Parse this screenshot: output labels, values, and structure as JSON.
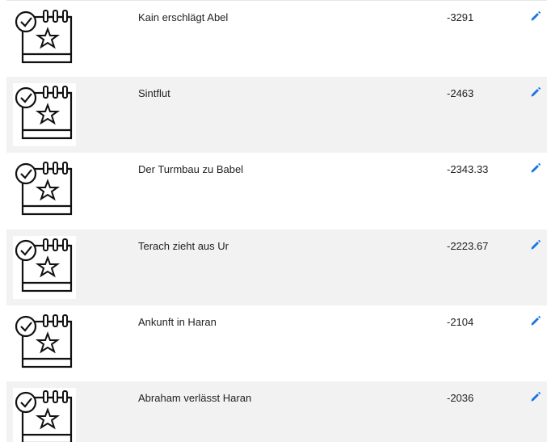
{
  "events": [
    {
      "title": "Kain erschlägt Abel",
      "year": "-3291",
      "icon": "calendar-star-check-icon"
    },
    {
      "title": "Sintflut",
      "year": "-2463",
      "icon": "calendar-star-check-icon"
    },
    {
      "title": "Der Turmbau zu Babel",
      "year": "-2343.33",
      "icon": "calendar-star-check-icon"
    },
    {
      "title": "Terach zieht aus Ur",
      "year": "-2223.67",
      "icon": "calendar-star-check-icon"
    },
    {
      "title": "Ankunft in Haran",
      "year": "-2104",
      "icon": "calendar-star-check-icon"
    },
    {
      "title": "Abraham verlässt Haran",
      "year": "-2036",
      "icon": "calendar-star-check-icon"
    }
  ],
  "colors": {
    "alt_row": "#f2f2f2",
    "edit_icon": "#1a73e8",
    "text": "#222222"
  },
  "edit_icon": "pencil-icon"
}
